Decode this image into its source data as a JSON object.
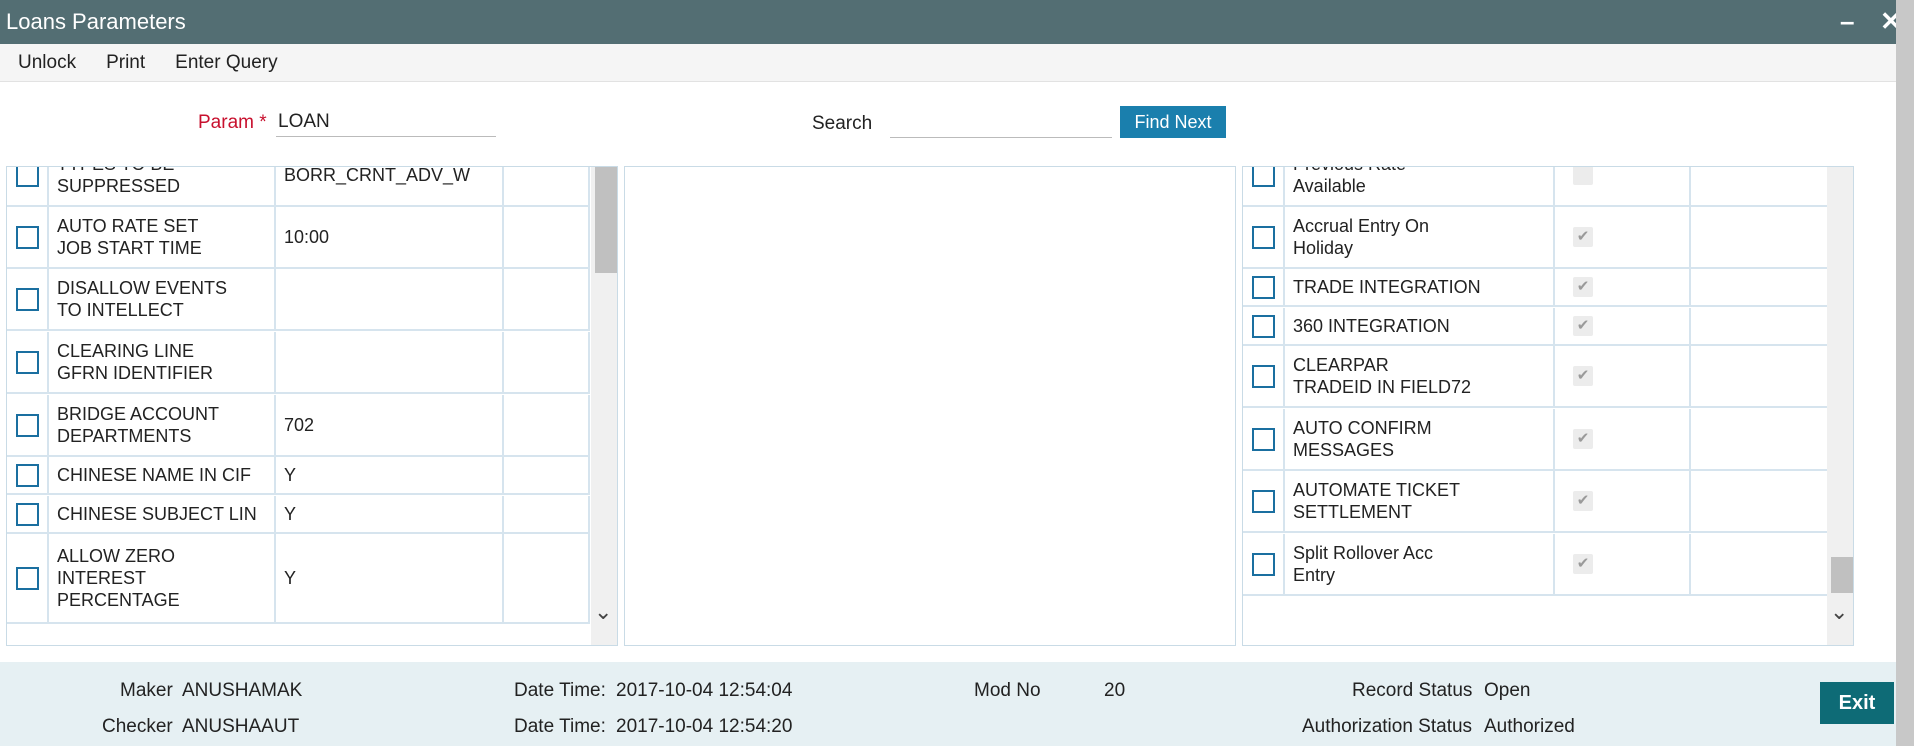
{
  "window": {
    "title": "Loans Parameters",
    "minimize_icon": "minimize-icon",
    "close_icon": "close-icon"
  },
  "menu": {
    "unlock": "Unlock",
    "print": "Print",
    "enter_query": "Enter Query"
  },
  "form": {
    "param_label": "Param",
    "required_mark": "*",
    "param_value": "LOAN",
    "search_label": "Search",
    "search_value": "",
    "find_next": "Find Next"
  },
  "left_rows": [
    {
      "label": "TYPES TO BE\nSUPPRESSED",
      "value": "BORR_CRNT_ADV_W"
    },
    {
      "label": "AUTO RATE SET\nJOB START TIME",
      "value": "10:00"
    },
    {
      "label": "DISALLOW EVENTS\nTO INTELLECT",
      "value": ""
    },
    {
      "label": "CLEARING LINE\nGFRN IDENTIFIER",
      "value": ""
    },
    {
      "label": "BRIDGE ACCOUNT\nDEPARTMENTS",
      "value": "702"
    },
    {
      "label": "CHINESE NAME IN CIF",
      "value": "Y"
    },
    {
      "label": "CHINESE SUBJECT LIN",
      "value": "Y"
    },
    {
      "label": "ALLOW ZERO\nINTEREST\nPERCENTAGE",
      "value": "Y"
    }
  ],
  "right_rows": [
    {
      "label": "Previous Rate\nAvailable",
      "checked": false
    },
    {
      "label": "Accrual Entry On\nHoliday",
      "checked": true
    },
    {
      "label": "TRADE INTEGRATION",
      "checked": true
    },
    {
      "label": "360 INTEGRATION",
      "checked": true
    },
    {
      "label": "CLEARPAR\nTRADEID IN FIELD72",
      "checked": true
    },
    {
      "label": "AUTO CONFIRM\nMESSAGES",
      "checked": true
    },
    {
      "label": "AUTOMATE TICKET\nSETTLEMENT",
      "checked": true
    },
    {
      "label": "Split Rollover Acc\nEntry",
      "checked": true
    }
  ],
  "footer": {
    "maker_label": "Maker",
    "maker": "ANUSHAMAK",
    "checker_label": "Checker",
    "checker": "ANUSHAAUT",
    "dt_label_1": "Date Time:",
    "dt_1": "2017-10-04 12:54:04",
    "dt_label_2": "Date Time:",
    "dt_2": "2017-10-04 12:54:20",
    "mod_label": "Mod No",
    "mod_no": "20",
    "record_status_label": "Record Status",
    "record_status": "Open",
    "auth_status_label": "Authorization Status",
    "auth_status": "Authorized",
    "exit": "Exit"
  }
}
